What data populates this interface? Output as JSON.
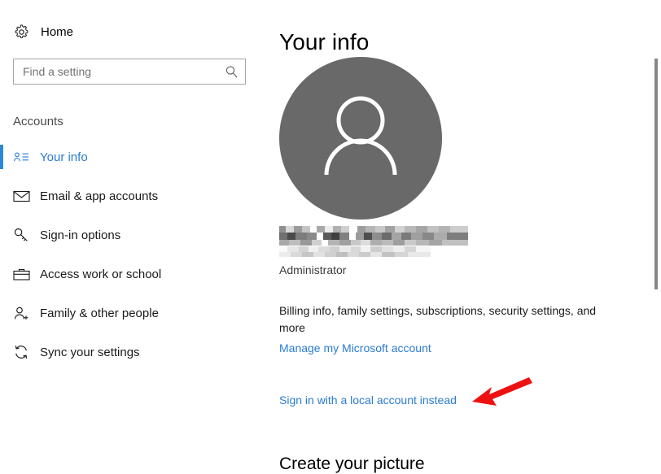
{
  "sidebar": {
    "home": {
      "label": "Home",
      "icon": "gear-icon"
    },
    "search": {
      "value": "",
      "placeholder": "Find a setting",
      "icon": "search-icon"
    },
    "section_header": "Accounts",
    "items": [
      {
        "label": "Your info",
        "icon": "contact-card-icon",
        "selected": true
      },
      {
        "label": "Email & app accounts",
        "icon": "envelope-icon",
        "selected": false
      },
      {
        "label": "Sign-in options",
        "icon": "key-icon",
        "selected": false
      },
      {
        "label": "Access work or school",
        "icon": "briefcase-icon",
        "selected": false
      },
      {
        "label": "Family & other people",
        "icon": "person-add-icon",
        "selected": false
      },
      {
        "label": "Sync your settings",
        "icon": "sync-icon",
        "selected": false
      }
    ]
  },
  "main": {
    "title": "Your info",
    "avatar": {
      "icon": "person-avatar-icon",
      "background_color": "#696969"
    },
    "account_name_redacted": "",
    "account_email_redacted": "",
    "account_role": "Administrator",
    "billing_text": "Billing info, family settings, subscriptions, security settings, and more",
    "manage_account_link": "Manage my Microsoft account",
    "local_account_link": "Sign in with a local account instead",
    "picture_section_title": "Create your picture"
  },
  "annotation": {
    "arrow": {
      "color": "#ee1111",
      "direction": "left",
      "points_at": "Sign in with a local account instead"
    }
  },
  "colors": {
    "accent_blue": "#2b88d8",
    "link_blue": "#2b7cd3",
    "annotation_red": "#ee1111",
    "scrollbar_thumb": "#878787"
  },
  "scrollbar": {
    "thumb_top_pct": 13,
    "thumb_height_pct": 50
  }
}
